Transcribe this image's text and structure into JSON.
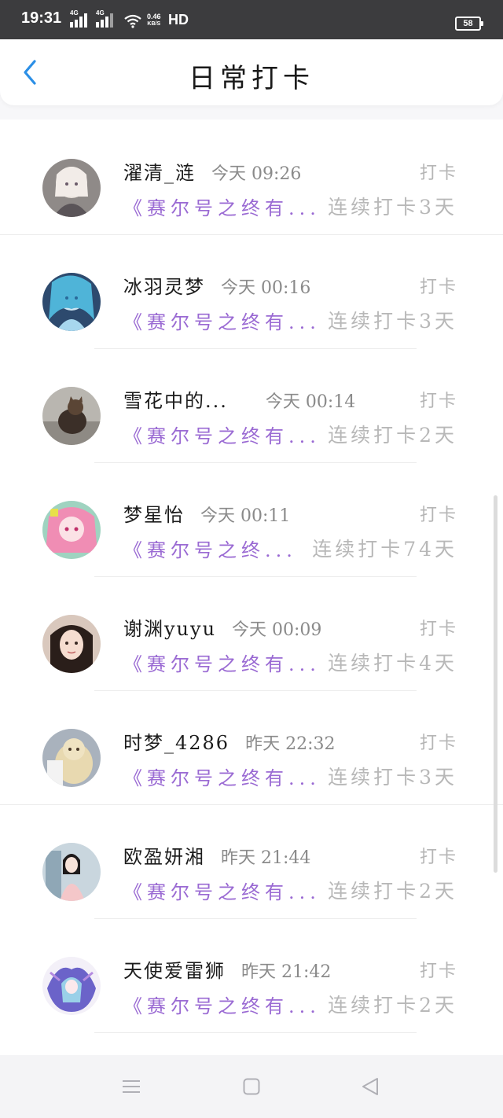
{
  "status_bar": {
    "time": "19:31",
    "sim1": "4G",
    "sim2": "4G",
    "speed_value": "0.46",
    "speed_unit": "KB/S",
    "hd": "HD",
    "battery": "58"
  },
  "header": {
    "title": "日常打卡",
    "back_icon": "chevron-left-icon"
  },
  "list": {
    "items": [
      {
        "name": "濯清_涟",
        "time": "今天 09:26",
        "checkin": "打卡",
        "book": "《赛尔号之终有...",
        "streak": "连续打卡3天"
      },
      {
        "name": "冰羽灵梦",
        "time": "今天 00:16",
        "checkin": "打卡",
        "book": "《赛尔号之终有...",
        "streak": "连续打卡3天"
      },
      {
        "name": "雪花中的...",
        "time": "今天 00:14",
        "checkin": "打卡",
        "book": "《赛尔号之终有...",
        "streak": "连续打卡2天"
      },
      {
        "name": "梦星怡",
        "time": "今天 00:11",
        "checkin": "打卡",
        "book": "《赛尔号之终...",
        "streak": "连续打卡74天"
      },
      {
        "name": "谢渊yuyu",
        "time": "今天 00:09",
        "checkin": "打卡",
        "book": "《赛尔号之终有...",
        "streak": "连续打卡4天"
      },
      {
        "name": "时梦_4286",
        "time": "昨天 22:32",
        "checkin": "打卡",
        "book": "《赛尔号之终有...",
        "streak": "连续打卡3天"
      },
      {
        "name": "欧盈妍湘",
        "time": "昨天 21:44",
        "checkin": "打卡",
        "book": "《赛尔号之终有...",
        "streak": "连续打卡2天"
      },
      {
        "name": "天使爱雷狮",
        "time": "昨天 21:42",
        "checkin": "打卡",
        "book": "《赛尔号之终有...",
        "streak": "连续打卡2天"
      }
    ]
  },
  "nav_bar": {
    "icons": [
      "menu-icon",
      "home-square-icon",
      "back-triangle-icon"
    ]
  },
  "colors": {
    "accent_book": "#9a6ad3",
    "back_arrow": "#2b8fe6",
    "status_bar_bg": "#3c3c3e"
  }
}
